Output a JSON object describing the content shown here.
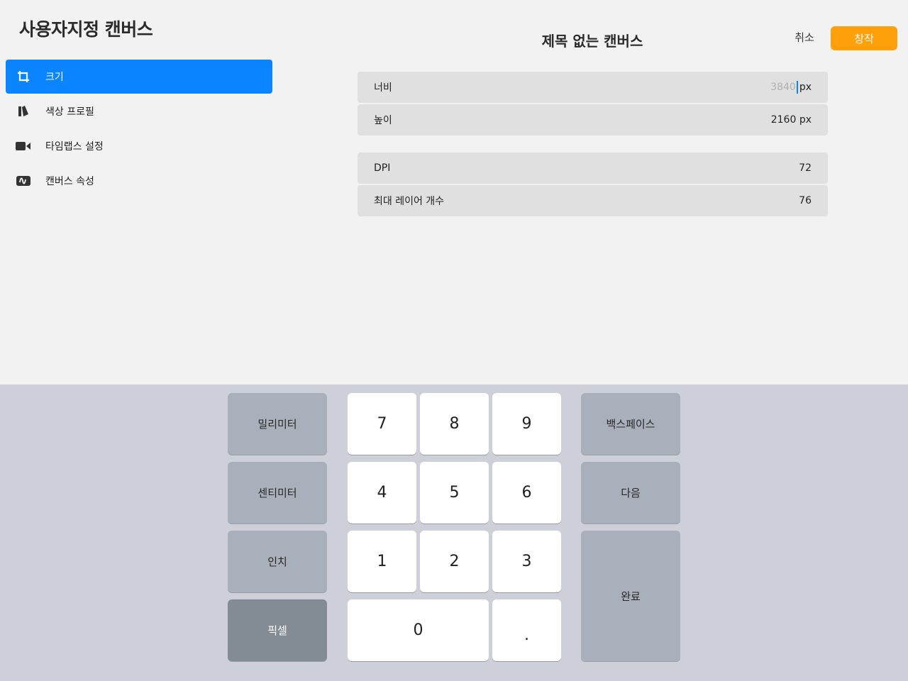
{
  "sidebar": {
    "title": "사용자지정 캔버스",
    "items": [
      {
        "label": "크기",
        "icon": "crop-icon",
        "active": true
      },
      {
        "label": "색상 프로필",
        "icon": "color-swatch-icon",
        "active": false
      },
      {
        "label": "타임랩스 설정",
        "icon": "video-camera-icon",
        "active": false
      },
      {
        "label": "캔버스 속성",
        "icon": "canvas-properties-icon",
        "active": false
      }
    ]
  },
  "header": {
    "title": "제목 없는 캔버스",
    "cancel_label": "취소",
    "create_label": "창작",
    "accent_color": "#ff9f0a"
  },
  "size_fields": {
    "width": {
      "label": "너비",
      "placeholder": "3840",
      "unit": "px"
    },
    "height": {
      "label": "높이",
      "value": "2160 px"
    },
    "dpi": {
      "label": "DPI",
      "value": "72"
    },
    "max_layers": {
      "label": "최대 레이어 개수",
      "value": "76"
    }
  },
  "keypad": {
    "units": [
      "밀리미터",
      "센티미터",
      "인치",
      "픽셀"
    ],
    "selected_unit": "픽셀",
    "digits": [
      "7",
      "8",
      "9",
      "4",
      "5",
      "6",
      "1",
      "2",
      "3",
      "0",
      "."
    ],
    "backspace_label": "백스페이스",
    "next_label": "다음",
    "done_label": "완료"
  },
  "colors": {
    "selection_blue": "#0a84ff",
    "keypad_background": "#cdd0d8"
  }
}
